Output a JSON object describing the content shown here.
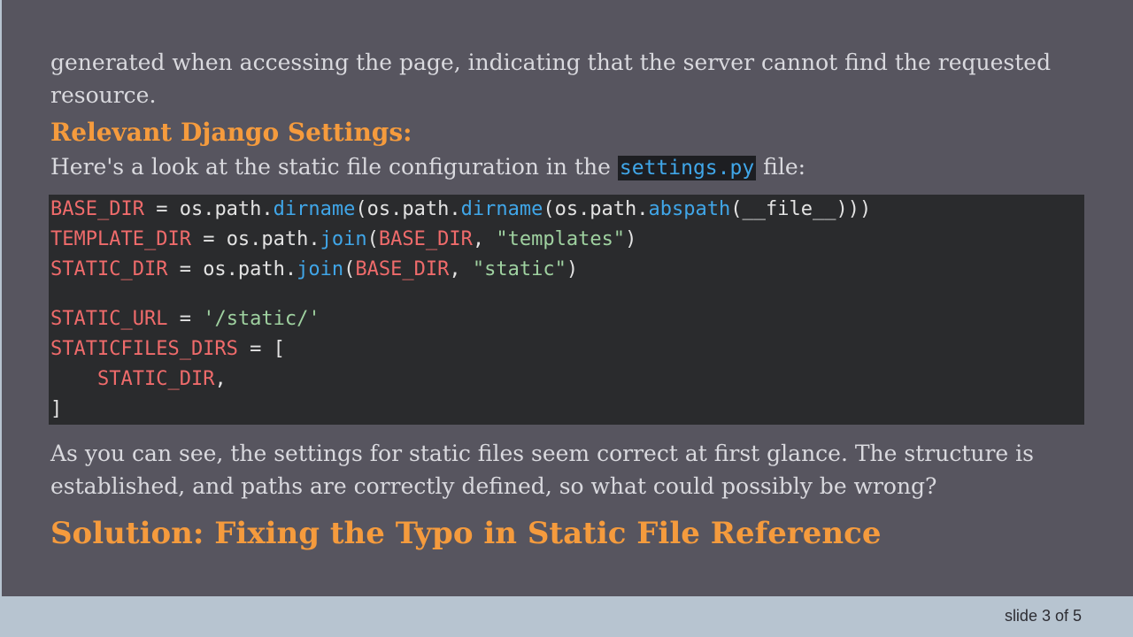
{
  "slide": {
    "intro_text": "generated when accessing the page, indicating that the server cannot find the requested resource.",
    "settings_heading": "Relevant Django Settings:",
    "settings_lead_before": "Here's a look at the static file configuration in the ",
    "settings_lead_code": "settings.py",
    "settings_lead_after": " file:",
    "code_lines": [
      [
        {
          "t": "BASE_DIR",
          "k": "var"
        },
        {
          "t": " = os.path.",
          "k": "plain"
        },
        {
          "t": "dirname",
          "k": "fn"
        },
        {
          "t": "(os.path.",
          "k": "plain"
        },
        {
          "t": "dirname",
          "k": "fn"
        },
        {
          "t": "(os.path.",
          "k": "plain"
        },
        {
          "t": "abspath",
          "k": "fn"
        },
        {
          "t": "(__file__)))",
          "k": "plain"
        }
      ],
      [
        {
          "t": "TEMPLATE_DIR",
          "k": "var"
        },
        {
          "t": " = os.path.",
          "k": "plain"
        },
        {
          "t": "join",
          "k": "fn"
        },
        {
          "t": "(",
          "k": "plain"
        },
        {
          "t": "BASE_DIR",
          "k": "var"
        },
        {
          "t": ", ",
          "k": "plain"
        },
        {
          "t": "\"templates\"",
          "k": "str"
        },
        {
          "t": ")",
          "k": "plain"
        }
      ],
      [
        {
          "t": "STATIC_DIR",
          "k": "var"
        },
        {
          "t": " = os.path.",
          "k": "plain"
        },
        {
          "t": "join",
          "k": "fn"
        },
        {
          "t": "(",
          "k": "plain"
        },
        {
          "t": "BASE_DIR",
          "k": "var"
        },
        {
          "t": ", ",
          "k": "plain"
        },
        {
          "t": "\"static\"",
          "k": "str"
        },
        {
          "t": ")",
          "k": "plain"
        }
      ],
      [],
      [
        {
          "t": "STATIC_URL",
          "k": "var"
        },
        {
          "t": " = ",
          "k": "plain"
        },
        {
          "t": "'/static/'",
          "k": "str"
        }
      ],
      [
        {
          "t": "STATICFILES_DIRS",
          "k": "var"
        },
        {
          "t": " = [",
          "k": "plain"
        }
      ],
      [
        {
          "t": "    ",
          "k": "plain"
        },
        {
          "t": "STATIC_DIR",
          "k": "var"
        },
        {
          "t": ",",
          "k": "plain"
        }
      ],
      [
        {
          "t": "]",
          "k": "plain"
        }
      ]
    ],
    "after_text": "As you can see, the settings for static files seem correct at first glance. The structure is established, and paths are correctly defined, so what could possibly be wrong?",
    "solution_heading": "Solution: Fixing the Typo in Static File Reference",
    "slide_number": "slide 3 of 5"
  },
  "colors": {
    "background": "#57555f",
    "accent_heading": "#f59b3d",
    "body_text": "#d9d9de",
    "code_background": "#2a2b2d",
    "code_variable": "#ef6b6b",
    "code_function": "#40a6e8",
    "code_string": "#9fd1a0",
    "footer_bar": "#b7c4d0"
  }
}
